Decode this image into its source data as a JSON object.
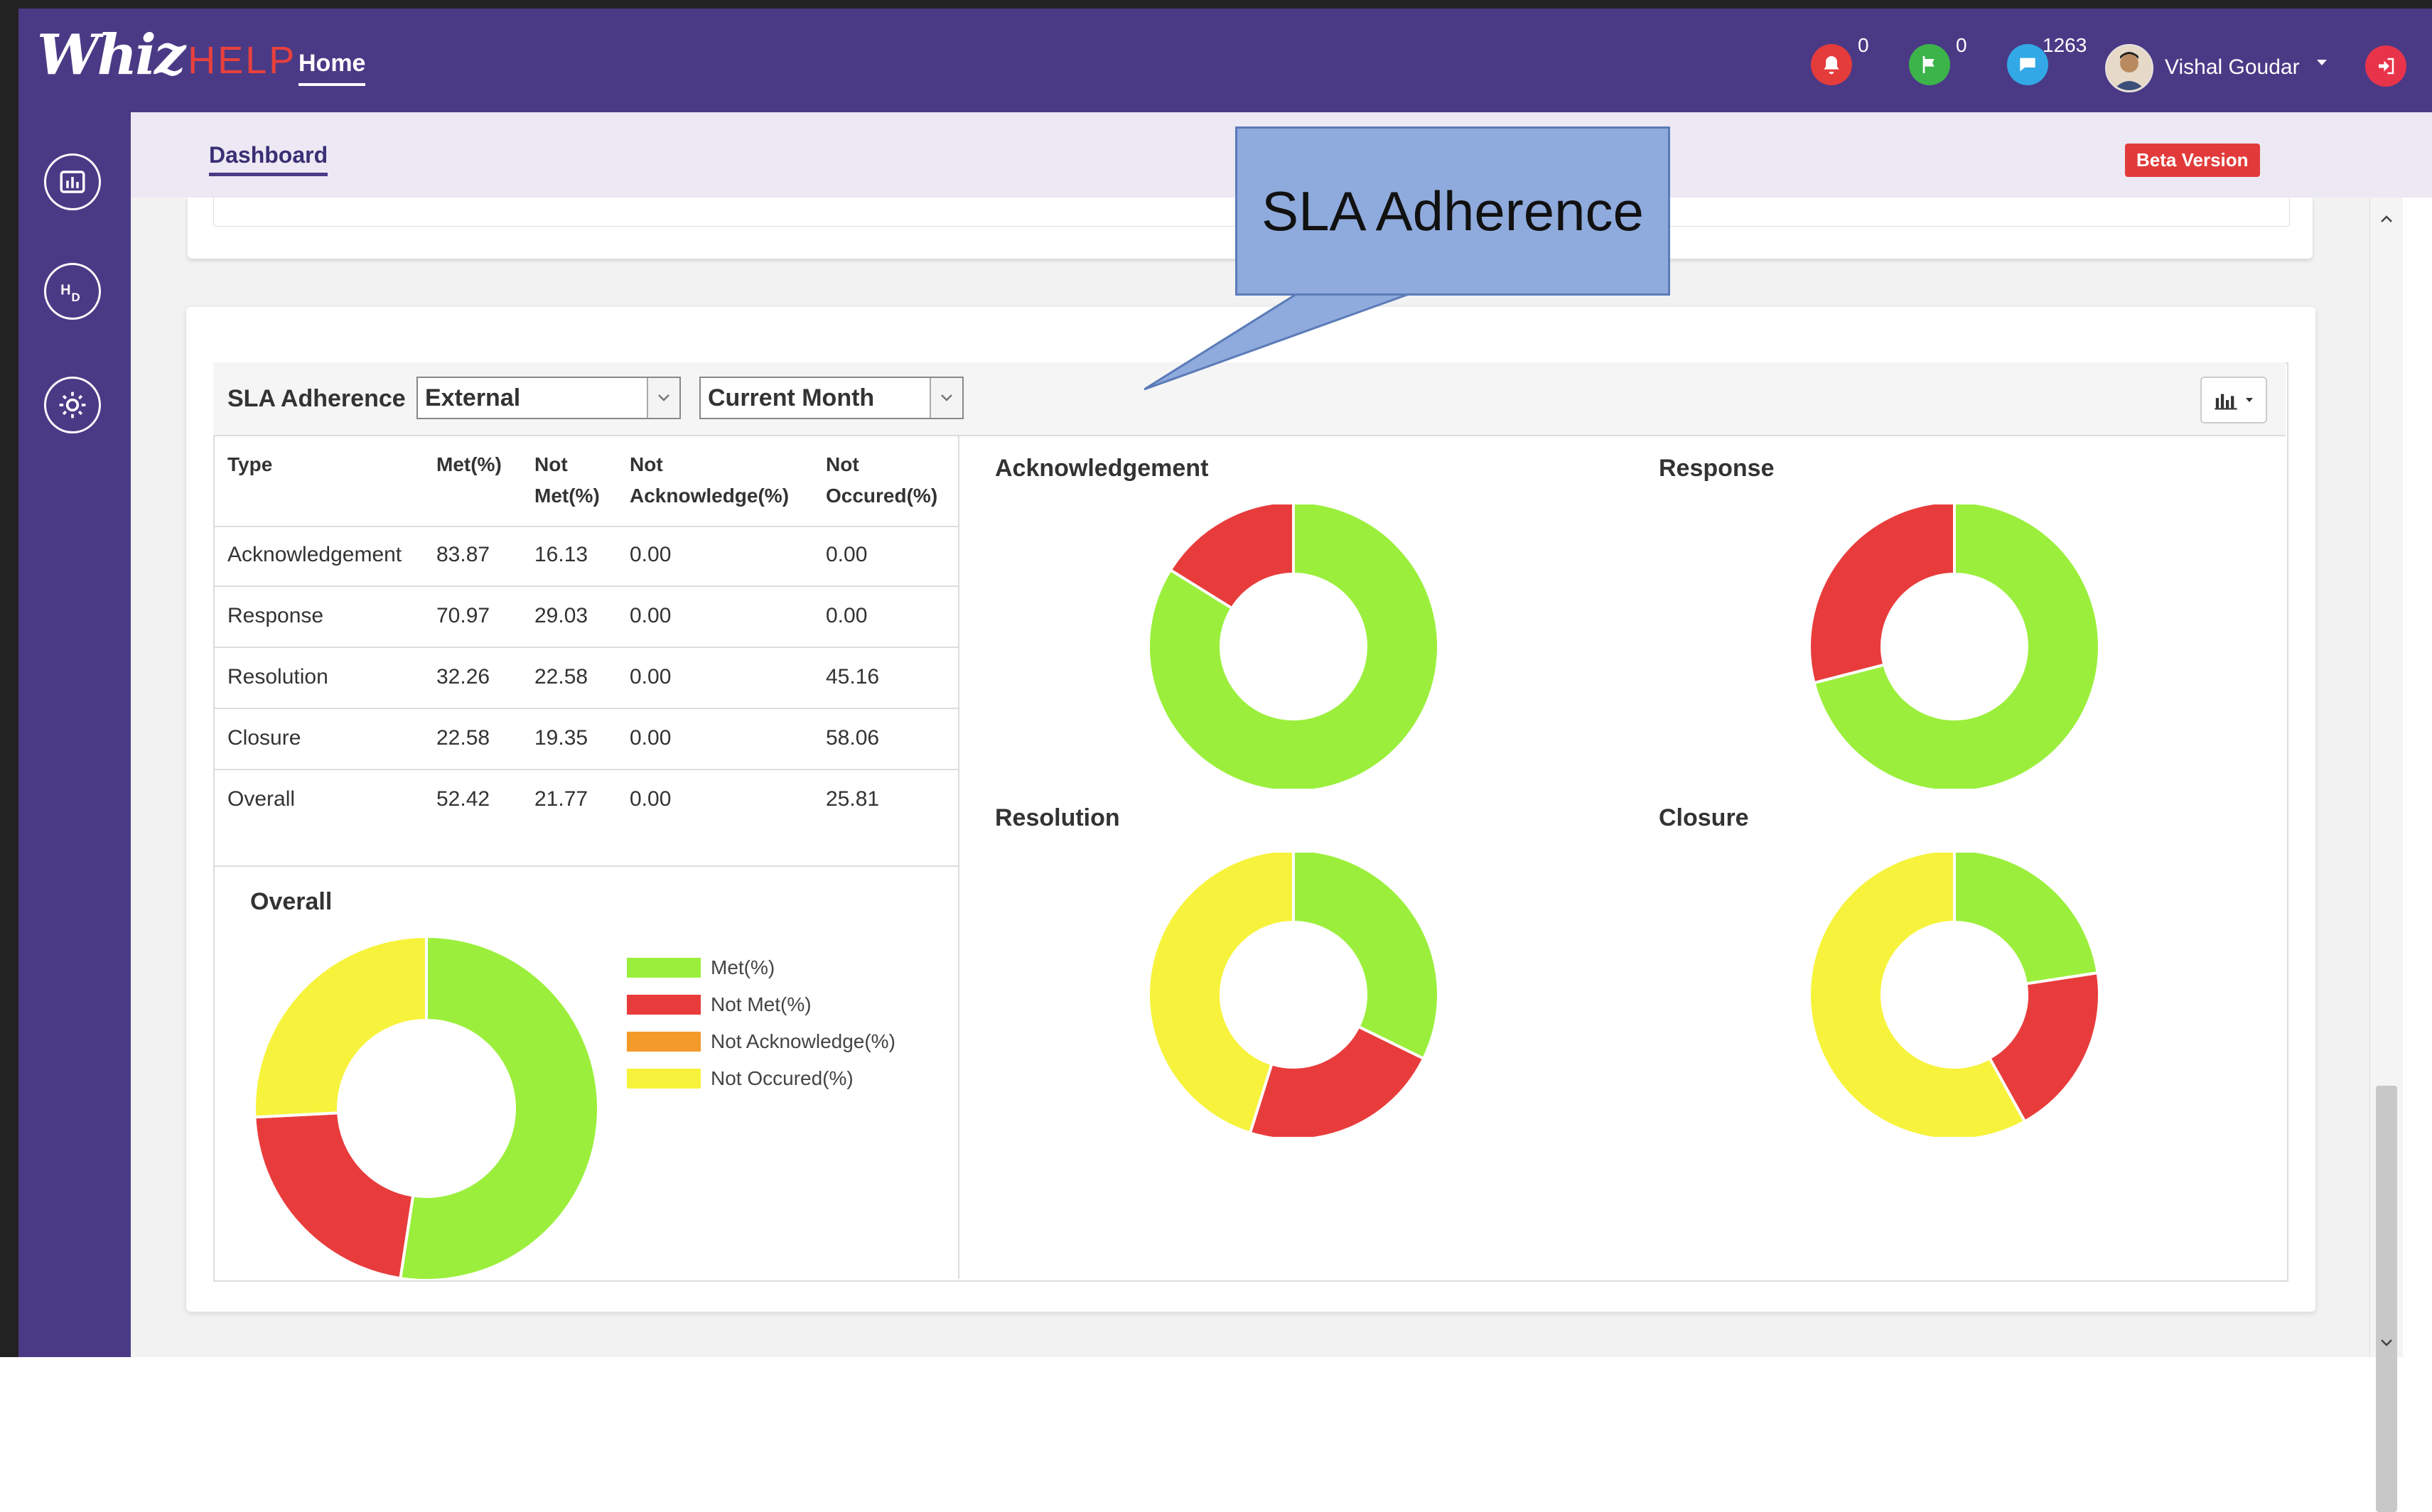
{
  "app": {
    "logo_main": "Whiz",
    "logo_sub": "HELP",
    "nav_home": "Home"
  },
  "notifications": [
    {
      "icon": "alert-icon",
      "count": "0",
      "color": "#e43b3b"
    },
    {
      "icon": "flag-icon",
      "count": "0",
      "color": "#3cb44a"
    },
    {
      "icon": "chat-icon",
      "count": "1263",
      "color": "#32a9e6"
    }
  ],
  "user": {
    "name": "Vishal Goudar"
  },
  "sidebar": {
    "items": [
      {
        "icon": "chart-icon"
      },
      {
        "icon": "hd-icon"
      },
      {
        "icon": "settings-icon"
      }
    ]
  },
  "subheader": {
    "tab": "Dashboard",
    "badge": "Beta Version"
  },
  "callout": {
    "text": "SLA Adherence"
  },
  "panel": {
    "title": "SLA Adherence",
    "type_select": "External",
    "period_select": "Current Month"
  },
  "table": {
    "headers": [
      {
        "line1": "Type",
        "line2": ""
      },
      {
        "line1": "Met(%)",
        "line2": ""
      },
      {
        "line1": "Not",
        "line2": "Met(%)"
      },
      {
        "line1": "Not",
        "line2": "Acknowledge(%)"
      },
      {
        "line1": "Not",
        "line2": "Occured(%)"
      }
    ],
    "rows": [
      [
        "Acknowledgement",
        "83.87",
        "16.13",
        "0.00",
        "0.00"
      ],
      [
        "Response",
        "70.97",
        "29.03",
        "0.00",
        "0.00"
      ],
      [
        "Resolution",
        "32.26",
        "22.58",
        "0.00",
        "45.16"
      ],
      [
        "Closure",
        "22.58",
        "19.35",
        "0.00",
        "58.06"
      ],
      [
        "Overall",
        "52.42",
        "21.77",
        "0.00",
        "25.81"
      ]
    ]
  },
  "legend": [
    {
      "label": "Met(%)",
      "color": "#9bef3c"
    },
    {
      "label": "Not Met(%)",
      "color": "#e83c3c"
    },
    {
      "label": "Not Acknowledge(%)",
      "color": "#f39a2b"
    },
    {
      "label": "Not Occured(%)",
      "color": "#f7f33c"
    }
  ],
  "chart_data": [
    {
      "type": "pie",
      "title": "Overall",
      "categories": [
        "Met(%)",
        "Not Met(%)",
        "Not Acknowledge(%)",
        "Not Occured(%)"
      ],
      "values": [
        52.42,
        21.77,
        0.0,
        25.81
      ]
    },
    {
      "type": "pie",
      "title": "Acknowledgement",
      "categories": [
        "Met(%)",
        "Not Met(%)",
        "Not Acknowledge(%)",
        "Not Occured(%)"
      ],
      "values": [
        83.87,
        16.13,
        0.0,
        0.0
      ]
    },
    {
      "type": "pie",
      "title": "Response",
      "categories": [
        "Met(%)",
        "Not Met(%)",
        "Not Acknowledge(%)",
        "Not Occured(%)"
      ],
      "values": [
        70.97,
        29.03,
        0.0,
        0.0
      ]
    },
    {
      "type": "pie",
      "title": "Resolution",
      "categories": [
        "Met(%)",
        "Not Met(%)",
        "Not Acknowledge(%)",
        "Not Occured(%)"
      ],
      "values": [
        32.26,
        22.58,
        0.0,
        45.16
      ]
    },
    {
      "type": "pie",
      "title": "Closure",
      "categories": [
        "Met(%)",
        "Not Met(%)",
        "Not Acknowledge(%)",
        "Not Occured(%)"
      ],
      "values": [
        22.58,
        19.35,
        0.0,
        58.06
      ]
    }
  ]
}
